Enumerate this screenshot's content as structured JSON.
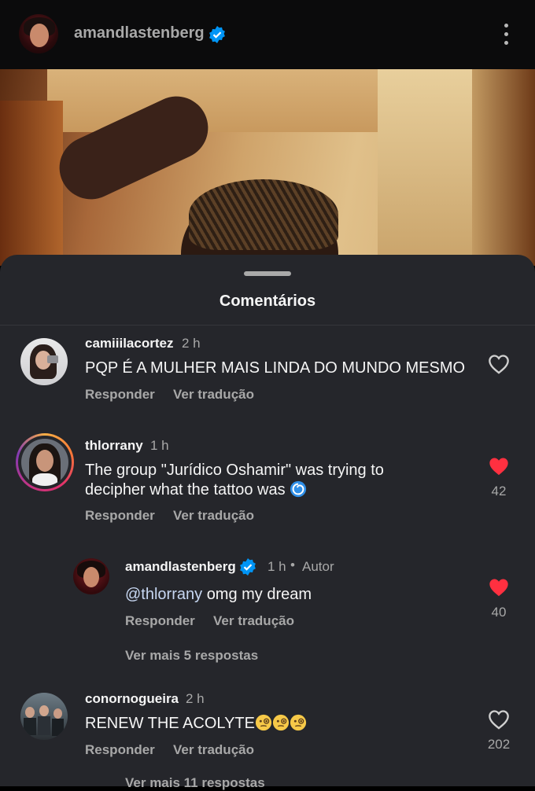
{
  "header": {
    "username": "amandlastenberg",
    "verified": true
  },
  "sheet": {
    "title": "Comentários"
  },
  "comments": [
    {
      "username": "camiiilacortez",
      "time": "2 h",
      "text": "PQP É A MULHER MAIS LINDA DO MUNDO MESMO",
      "reply_label": "Responder",
      "translate_label": "Ver tradução",
      "liked": false,
      "likes": ""
    },
    {
      "username": "thlorrany",
      "time": "1 h",
      "text_line1": "The group \"Jurídico Oshamir\" was trying to",
      "text_line2": "decipher what the tattoo was",
      "emoji": "cyclone",
      "reply_label": "Responder",
      "translate_label": "Ver tradução",
      "liked": true,
      "likes": "42",
      "replies": [
        {
          "username": "amandlastenberg",
          "verified": true,
          "time": "1 h",
          "author_badge": "Autor",
          "mention": "@thlorrany",
          "text": "omg my dream",
          "reply_label": "Responder",
          "translate_label": "Ver tradução",
          "liked": true,
          "likes": "40"
        }
      ],
      "more_replies": "Ver mais 5 respostas"
    },
    {
      "username": "conornogueira",
      "time": "2 h",
      "text": "RENEW THE ACOLYTE",
      "emoji": "face-with-monocle x3",
      "reply_label": "Responder",
      "translate_label": "Ver tradução",
      "liked": false,
      "likes": "202",
      "more_replies": "Ver mais 11 respostas"
    }
  ],
  "colors": {
    "sheet_bg": "#25262b",
    "text_primary": "#f5f5f5",
    "text_secondary": "#a8a8a8",
    "liked_heart": "#ff3040",
    "verified_blue": "#0095f6",
    "mention": "#c7d7f2"
  }
}
